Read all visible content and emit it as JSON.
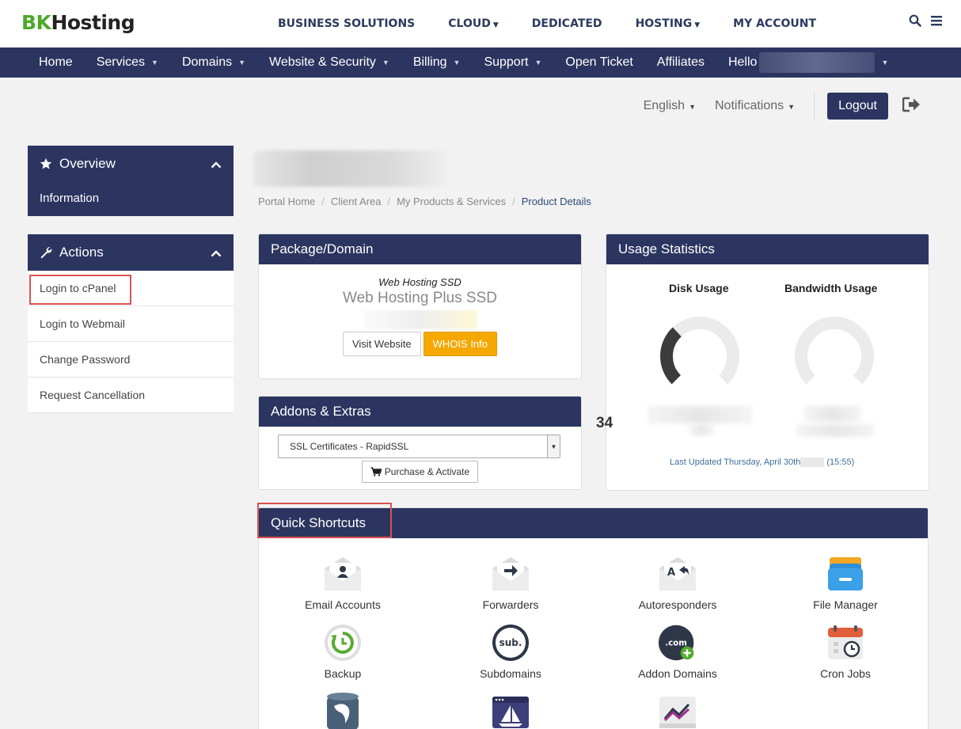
{
  "brand": {
    "logo_prefix": "BK",
    "logo_suffix": "Hosting"
  },
  "top_nav": [
    {
      "label": "BUSINESS SOLUTIONS",
      "has_caret": false
    },
    {
      "label": "CLOUD",
      "has_caret": true
    },
    {
      "label": "DEDICATED",
      "has_caret": false
    },
    {
      "label": "HOSTING",
      "has_caret": true
    },
    {
      "label": "MY ACCOUNT",
      "has_caret": false
    }
  ],
  "main_nav": {
    "home": "Home",
    "services": "Services",
    "domains": "Domains",
    "website_security": "Website & Security",
    "billing": "Billing",
    "support": "Support",
    "open_ticket": "Open Ticket",
    "affiliates": "Affiliates",
    "hello": "Hello"
  },
  "utility": {
    "language": "English",
    "notifications": "Notifications",
    "logout": "Logout"
  },
  "sidebar": {
    "overview_title": "Overview",
    "overview_item": "Information",
    "actions_title": "Actions",
    "actions": [
      "Login to cPanel",
      "Login to Webmail",
      "Change Password",
      "Request Cancellation"
    ]
  },
  "breadcrumb": [
    "Portal Home",
    "Client Area",
    "My Products & Services",
    "Product Details"
  ],
  "package": {
    "title": "Package/Domain",
    "type": "Web Hosting SSD",
    "name": "Web Hosting Plus SSD",
    "visit_button": "Visit Website",
    "whois_button": "WHOIS Info"
  },
  "addons": {
    "title": "Addons & Extras",
    "selected_option": "SSL Certificates - RapidSSL",
    "purchase_button": "Purchase & Activate"
  },
  "usage": {
    "title": "Usage Statistics",
    "disk_label": "Disk Usage",
    "bandwidth_label": "Bandwidth Usage",
    "disk_used_fraction": 0.34,
    "bandwidth_used_fraction": 0,
    "last_updated_prefix": "Last Updated Thursday, April 30th",
    "last_updated_time": "(15:55)"
  },
  "stray_number": "34",
  "shortcuts": {
    "title": "Quick Shortcuts",
    "items": [
      {
        "label": "Email Accounts",
        "icon": "email-accounts-icon"
      },
      {
        "label": "Forwarders",
        "icon": "forwarders-icon"
      },
      {
        "label": "Autoresponders",
        "icon": "autoresponders-icon"
      },
      {
        "label": "File Manager",
        "icon": "file-manager-icon"
      },
      {
        "label": "Backup",
        "icon": "backup-icon"
      },
      {
        "label": "Subdomains",
        "icon": "subdomains-icon"
      },
      {
        "label": "Addon Domains",
        "icon": "addon-domains-icon"
      },
      {
        "label": "Cron Jobs",
        "icon": "cron-jobs-icon"
      },
      {
        "label": "",
        "icon": "mysql-databases-icon"
      },
      {
        "label": "",
        "icon": "website-builder-icon"
      },
      {
        "label": "",
        "icon": "awstats-icon"
      }
    ]
  },
  "colors": {
    "nav": "#2c3560",
    "brand_green": "#4caa2a",
    "accent_yellow": "#f5a800",
    "highlight": "#d9534f"
  }
}
